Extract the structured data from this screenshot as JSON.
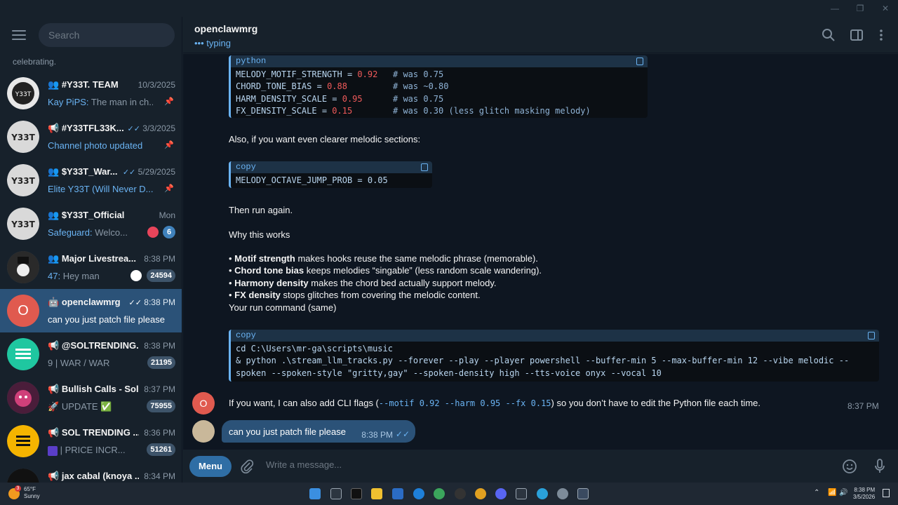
{
  "sidebar": {
    "search_placeholder": "Search",
    "prev_line": "celebrating.",
    "chats": [
      {
        "title": "#Y33T. TEAM",
        "time": "10/3/2025",
        "sender": "Kay PiPS:",
        "preview": " The man in ch...",
        "badge": ""
      },
      {
        "title": "#Y33TFL33K...",
        "time": "3/3/2025",
        "sender": "",
        "preview": "Channel photo updated",
        "badge": ""
      },
      {
        "title": "$Y33T_War...",
        "time": "5/29/2025",
        "sender": "",
        "preview": "Elite Y33T (Will Never D...",
        "badge": ""
      },
      {
        "title": "$Y33T_Official",
        "time": "Mon",
        "sender": "Safeguard:",
        "preview": " Welco...",
        "badge": "6"
      },
      {
        "title": "Major Livestrea...",
        "time": "8:38 PM",
        "sender": "47:",
        "preview": " Hey man",
        "badge": "24594"
      },
      {
        "title": "openclawmrg",
        "time": "8:38 PM",
        "sender": "",
        "preview": "can you just patch file please",
        "badge": "",
        "avatar_letter": "O"
      },
      {
        "title": "@SOLTRENDING...",
        "time": "8:38 PM",
        "sender": "",
        "preview": "9 | WAR / WAR",
        "badge": "21195"
      },
      {
        "title": "Bullish Calls - Sol...",
        "time": "8:37 PM",
        "sender": "",
        "preview": "UPDATE",
        "badge": "75955"
      },
      {
        "title": "SOL TRENDING ...",
        "time": "8:36 PM",
        "sender": "",
        "preview": "| PRICE INCR...",
        "badge": "51261"
      },
      {
        "title": "jax cabal (knoya ...",
        "time": "8:34 PM",
        "sender": "",
        "preview": "",
        "badge": ""
      }
    ]
  },
  "header": {
    "title": "openclawmrg",
    "status": "••• typing"
  },
  "messages": {
    "code1": {
      "lang": "python",
      "lines": [
        {
          "name": "MELODY_MOTIF_STRENGTH",
          "val": "0.92",
          "comment": "# was 0.75"
        },
        {
          "name": "CHORD_TONE_BIAS",
          "val": "0.88",
          "comment": "# was ~0.80"
        },
        {
          "name": "HARM_DENSITY_SCALE",
          "val": "0.95",
          "comment": "# was 0.75"
        },
        {
          "name": "FX_DENSITY_SCALE",
          "val": "0.15",
          "comment": "# was 0.30 (less glitch masking melody)"
        }
      ]
    },
    "also_text": "Also, if you want even clearer melodic sections:",
    "code2": {
      "lang": "copy",
      "line": "MELODY_OCTAVE_JUMP_PROB = 0.05"
    },
    "then_text": "Then run again.",
    "why_text": "Why this works",
    "bullets": [
      {
        "bold": "Motif strength",
        "rest": " makes hooks reuse the same melodic phrase (memorable)."
      },
      {
        "bold": "Chord tone bias",
        "rest": " keeps melodies “singable” (less random scale wandering)."
      },
      {
        "bold": "Harmony density",
        "rest": " makes the chord bed actually support melody."
      },
      {
        "bold": "FX density",
        "rest": " stops glitches from covering the melodic content."
      }
    ],
    "run_text": "Your run command (same)",
    "code3": {
      "lang": "copy",
      "lines": [
        "cd C:\\Users\\mr-ga\\scripts\\music",
        "& python .\\stream_llm_tracks.py --forever --play --player powershell --buffer-min 5 --max-buffer-min 12 --vibe melodic --",
        "spoken --spoken-style \"gritty,gay\" --spoken-density high --tts-voice onyx --vocal 10"
      ]
    },
    "last_pre": "If you want, I can also add CLI flags (",
    "last_code": "--motif 0.92 --harm 0.95 --fx 0.15",
    "last_post": ") so you don’t have to edit the Python file each time.",
    "last_time": "8:37 PM",
    "sender_letter": "O",
    "out_text": "can you just patch file please",
    "out_time": "8:38 PM"
  },
  "composer": {
    "menu_label": "Menu",
    "placeholder": "Write a message..."
  },
  "taskbar": {
    "temp": "65°F",
    "weather": "Sunny",
    "time": "8:38 PM",
    "date": "3/5/2026",
    "weather_badge": "3"
  },
  "colors": {
    "accent": "#6ab3f3",
    "active_chat": "#2b5278",
    "bg": "#0e1621",
    "panel": "#17212b"
  }
}
